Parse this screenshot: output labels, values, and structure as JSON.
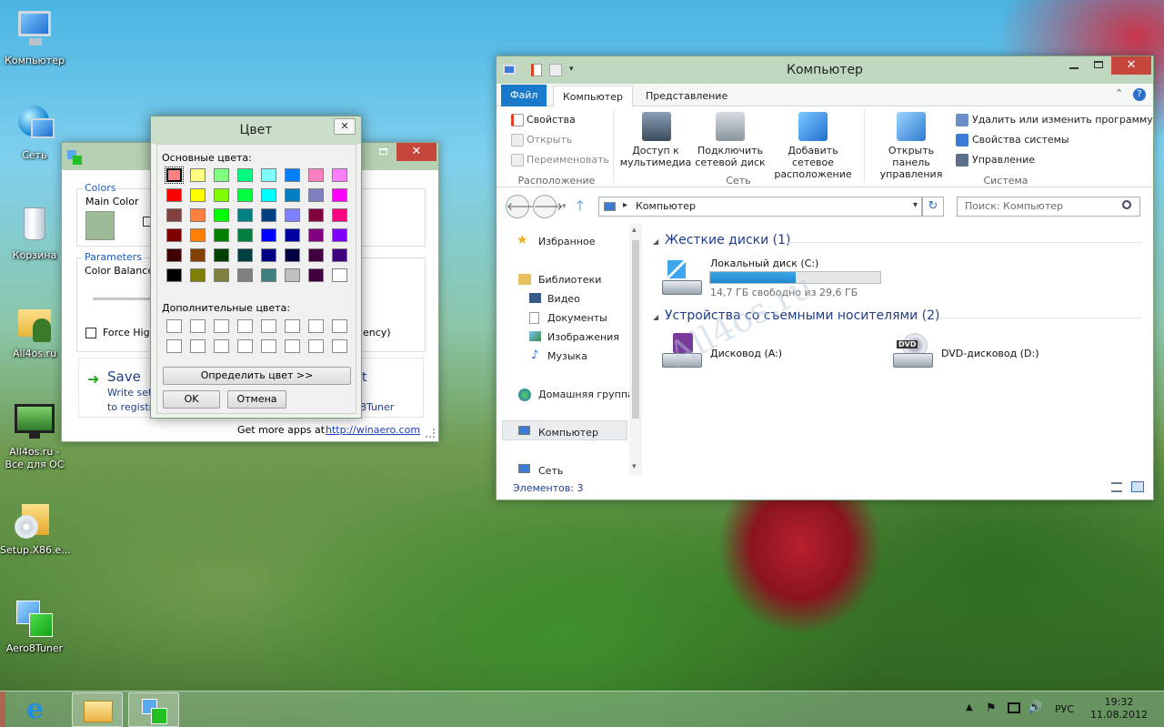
{
  "desktop": {
    "icons": [
      {
        "label": "Компьютер",
        "icon": "computer-icon"
      },
      {
        "label": "Сеть",
        "icon": "network-icon"
      },
      {
        "label": "Корзина",
        "icon": "recycle-bin-icon"
      },
      {
        "label": "All4os.ru",
        "icon": "folder-user-icon"
      },
      {
        "label": "All4os.ru -\nВсе для ОС",
        "icon": "monitor-shortcut-icon"
      },
      {
        "label": "Setup.X86.e...",
        "icon": "setup-icon"
      },
      {
        "label": "Aero8Tuner",
        "icon": "aero8tuner-icon"
      }
    ]
  },
  "taskbar": {
    "buttons": [
      {
        "name": "internet-explorer",
        "icon": "ie-icon"
      },
      {
        "name": "file-explorer",
        "icon": "folder-icon"
      },
      {
        "name": "aero8tuner",
        "icon": "aero8tuner-icon"
      }
    ],
    "tray": {
      "language": "РУС",
      "time": "19:32",
      "date": "11.08.2012"
    }
  },
  "tuner": {
    "colors_group": "Colors",
    "main_color_label": "Main Color",
    "main_color": "#9dbb96",
    "parameters_group": "Parameters",
    "color_balance_label": "Color Balance",
    "force_high_label": "Force High",
    "transparency_tail": "ency)",
    "save_label": "Save",
    "save_desc_1": "Write setti",
    "save_desc_2": "to registr",
    "right_text_1": "t",
    "right_text_2": "8Tuner",
    "more_apps": "Get more apps at",
    "link": "http://winaero.com"
  },
  "color_dialog": {
    "title": "Цвет",
    "basic_label": "Основные цвета:",
    "custom_label": "Дополнительные цвета:",
    "define_button": "Определить цвет >>",
    "ok_button": "OK",
    "cancel_button": "Отмена",
    "basic_colors": [
      [
        "#ff8080",
        "#ffff80",
        "#80ff80",
        "#00ff80",
        "#80ffff",
        "#0080ff",
        "#ff80c0",
        "#ff80ff"
      ],
      [
        "#ff0000",
        "#ffff00",
        "#80ff00",
        "#00ff40",
        "#00ffff",
        "#0080c0",
        "#8080c0",
        "#ff00ff"
      ],
      [
        "#804040",
        "#ff8040",
        "#00ff00",
        "#008080",
        "#004080",
        "#8080ff",
        "#800040",
        "#ff0080"
      ],
      [
        "#800000",
        "#ff8000",
        "#008000",
        "#008040",
        "#0000ff",
        "#0000a0",
        "#800080",
        "#8000ff"
      ],
      [
        "#400000",
        "#804000",
        "#004000",
        "#004040",
        "#000080",
        "#000040",
        "#400040",
        "#400080"
      ],
      [
        "#000000",
        "#808000",
        "#808040",
        "#808080",
        "#408080",
        "#c0c0c0",
        "#400040",
        "#ffffff"
      ]
    ]
  },
  "explorer": {
    "title": "Компьютер",
    "tabs": [
      "Файл",
      "Компьютер",
      "Представление"
    ],
    "ribbon": {
      "location": {
        "items": [
          "Свойства",
          "Открыть",
          "Переименовать"
        ],
        "group": "Расположение"
      },
      "network": {
        "media_1": "Доступ к",
        "media_2": "мультимедиа",
        "drive_1": "Подключить",
        "drive_2": "сетевой диск",
        "loc_1": "Добавить сетевое",
        "loc_2": "расположение",
        "group": "Сеть"
      },
      "system": {
        "cp_1": "Открыть панель",
        "cp_2": "управления",
        "uninstall": "Удалить или изменить программу",
        "props": "Свойства системы",
        "manage": "Управление",
        "group": "Система"
      }
    },
    "address": "Компьютер",
    "search_placeholder": "Поиск: Компьютер",
    "nav": [
      "Избранное",
      "Библиотеки",
      "Видео",
      "Документы",
      "Изображения",
      "Музыка",
      "Домашняя группа",
      "Компьютер",
      "Сеть"
    ],
    "sections": {
      "hdd": "Жесткие диски (1)",
      "removable": "Устройства со съемными носителями (2)"
    },
    "drives": {
      "c_name": "Локальный диск (C:)",
      "c_free": "14,7 ГБ свободно из 29,6 ГБ",
      "c_used_fraction": 0.503,
      "a_name": "Дисковод (A:)",
      "d_name": "DVD-дисковод (D:)"
    },
    "status": "Элементов: 3",
    "watermark": "All4os.ru"
  }
}
